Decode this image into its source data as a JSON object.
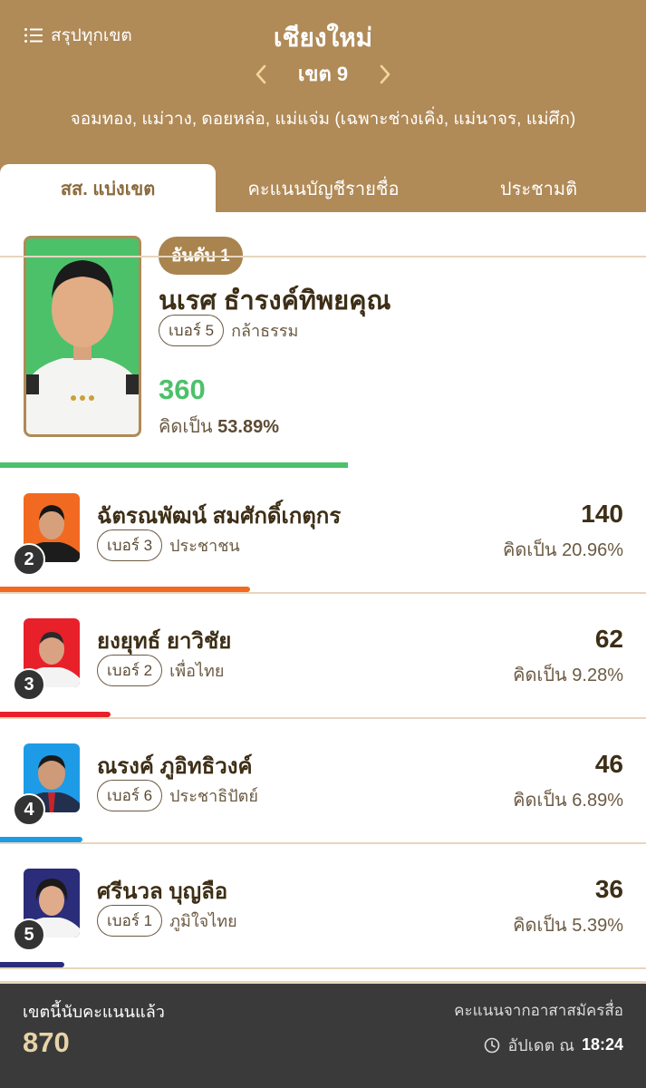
{
  "header": {
    "summary_label": "สรุปทุกเขต",
    "province": "เชียงใหม่",
    "district": "เขต 9",
    "areas": "จอมทอง, แม่วาง, ดอยหล่อ, แม่แจ่ม (เฉพาะช่างเคิ่ง, แม่นาจร, แม่ศึก)"
  },
  "tabs": [
    {
      "label": "สส. แบ่งเขต",
      "active": true
    },
    {
      "label": "คะแนนบัญชีรายชื่อ",
      "active": false
    },
    {
      "label": "ประชามติ",
      "active": false
    }
  ],
  "winner": {
    "rank_label": "อันดับ 1",
    "name": "นเรศ ธำรงค์ทิพยคุณ",
    "number_label": "เบอร์ 5",
    "party": "กล้าธรรม",
    "votes": "360",
    "pct_prefix": "คิดเป็น",
    "pct": "53.89%",
    "share": 0.5389,
    "color": "#4cc16a"
  },
  "candidates": [
    {
      "rank": "2",
      "name": "ฉัตรณพัฒน์ สมศักดิ์เกตุกร",
      "number_label": "เบอร์ 3",
      "party": "ประชาชน",
      "votes": "140",
      "pct_label": "คิดเป็น 20.96%",
      "share": 0.2096,
      "color": "#f26a21"
    },
    {
      "rank": "3",
      "name": "ยงยุทธ์ ยาวิชัย",
      "number_label": "เบอร์ 2",
      "party": "เพื่อไทย",
      "votes": "62",
      "pct_label": "คิดเป็น 9.28%",
      "share": 0.0928,
      "color": "#e8202a"
    },
    {
      "rank": "4",
      "name": "ณรงค์ ภูอิทธิวงค์",
      "number_label": "เบอร์ 6",
      "party": "ประชาธิปัตย์",
      "votes": "46",
      "pct_label": "คิดเป็น 6.89%",
      "share": 0.0689,
      "color": "#1e9be6"
    },
    {
      "rank": "5",
      "name": "ศรีนวล บุญลือ",
      "number_label": "เบอร์ 1",
      "party": "ภูมิใจไทย",
      "votes": "36",
      "pct_label": "คิดเป็น 5.39%",
      "share": 0.0539,
      "color": "#2b2d7a"
    }
  ],
  "footer": {
    "counted_label": "เขตนี้นับคะแนนแล้ว",
    "total": "870",
    "source": "คะแนนจากอาสาสมัครสื่อ",
    "update_prefix": "อัปเดต ณ",
    "update_time": "18:24"
  }
}
